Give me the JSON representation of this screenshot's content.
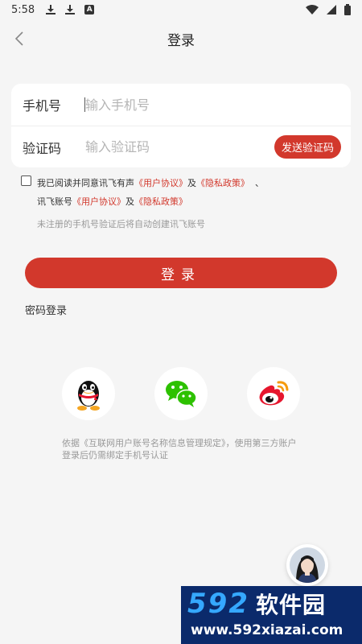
{
  "status_bar": {
    "time": "5:58"
  },
  "nav": {
    "title": "登录"
  },
  "form": {
    "phone_label": "手机号",
    "phone_placeholder": "输入手机号",
    "code_label": "验证码",
    "code_placeholder": "输入验证码",
    "send_code_label": "发送验证码"
  },
  "agreement": {
    "prefix": "我已阅读并同意讯飞有声",
    "user_agreement": "《用户协议》",
    "and": "及",
    "privacy_policy": "《隐私政策》",
    "sep": "、",
    "prefix2": "讯飞账号",
    "user_agreement2": "《用户协议》",
    "and2": "及",
    "privacy_policy2": "《隐私政策》",
    "note": "未注册的手机号验证后将自动创建讯飞账号"
  },
  "login_button": "登录",
  "password_login": "密码登录",
  "social": {
    "items": [
      "qq",
      "wechat",
      "weibo"
    ]
  },
  "bottom_note": "依据《互联网用户账号名称信息管理规定》，使用第三方账户登录后仍需绑定手机号认证",
  "watermark": {
    "num": "592",
    "cn": "软件园",
    "url": "www.592xiazai.com"
  },
  "colors": {
    "accent": "#d2382c",
    "background": "#f5f5f5",
    "wechat": "#2dc100",
    "qq_body": "#111111",
    "weibo_red": "#e6162d",
    "weibo_orange": "#f59b0e"
  }
}
